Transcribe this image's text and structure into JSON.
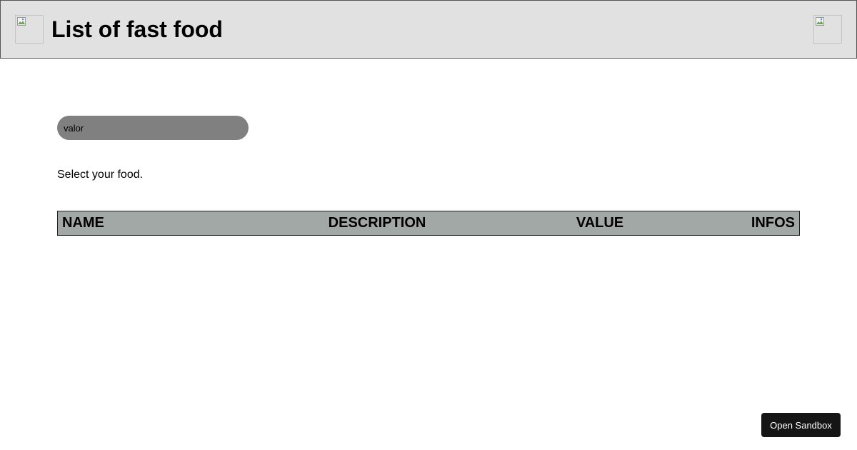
{
  "header": {
    "title": "List of fast food",
    "logo_icon": "broken-image-icon",
    "profile_icon": "broken-image-icon"
  },
  "search": {
    "placeholder": "valor"
  },
  "instruction": "Select your food.",
  "table": {
    "columns": [
      "NAME",
      "DESCRIPTION",
      "VALUE",
      "INFOS"
    ],
    "rows": []
  },
  "sandbox_button": "Open Sandbox",
  "colors": {
    "header_bg": "#e1e1e1",
    "search_bg": "#808080",
    "table_header_bg": "#a2a8a6",
    "button_bg": "#151515"
  }
}
